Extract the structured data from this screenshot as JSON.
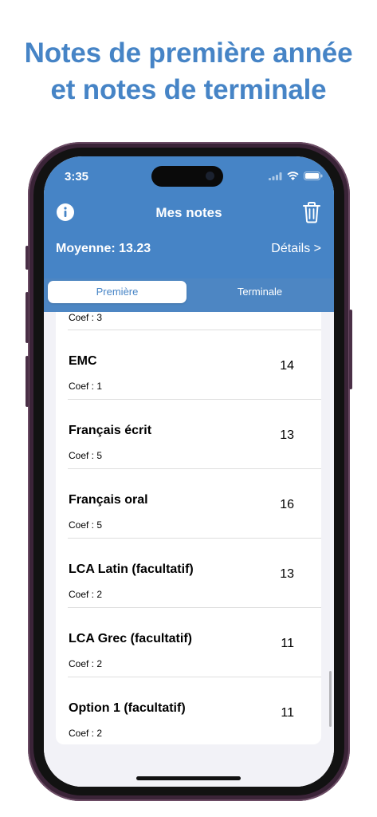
{
  "headline": {
    "line1": "Notes de première année",
    "line2": "et notes de terminale"
  },
  "status": {
    "time": "3:35",
    "icons": [
      "signal-icon",
      "wifi-icon",
      "battery-icon"
    ]
  },
  "nav": {
    "title": "Mes notes",
    "left_icon": "info-icon",
    "right_icon": "trash-icon"
  },
  "summary": {
    "average_label": "Moyenne: 13.23",
    "details_label": "Détails >"
  },
  "tabs": {
    "items": [
      {
        "label": "Première",
        "selected": true
      },
      {
        "label": "Terminale",
        "selected": false
      }
    ]
  },
  "list": {
    "partial_coef": "Coef : 3",
    "rows": [
      {
        "subject": "EMC",
        "coef": "Coef : 1",
        "grade": "14"
      },
      {
        "subject": "Français écrit",
        "coef": "Coef : 5",
        "grade": "13"
      },
      {
        "subject": "Français oral",
        "coef": "Coef : 5",
        "grade": "16"
      },
      {
        "subject": "LCA Latin (facultatif)",
        "coef": "Coef : 2",
        "grade": "13"
      },
      {
        "subject": "LCA Grec (facultatif)",
        "coef": "Coef : 2",
        "grade": "11"
      },
      {
        "subject": "Option 1 (facultatif)",
        "coef": "Coef : 2",
        "grade": "11"
      }
    ]
  },
  "colors": {
    "accent": "#4684c6",
    "background": "#f2f2f7",
    "frame": "#3b2438"
  }
}
